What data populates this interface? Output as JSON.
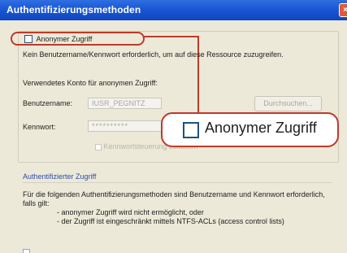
{
  "window": {
    "title": "Authentifizierungsmethoden",
    "close_label": "×"
  },
  "anonymous": {
    "checkbox_label": "Anonymer Zugriff",
    "checked": false,
    "description": "Kein Benutzername/Kennwort erforderlich, um auf diese Ressource zuzugreifen.",
    "account_label": "Verwendetes Konto für anonymen Zugriff:",
    "username_label": "Benutzername:",
    "username_value": "IUSR_PEGNITZ",
    "password_label": "Kennwort:",
    "password_value": "**********",
    "browse_label": "Durchsuchen...",
    "password_control_label": "Kennwortsteuerung zulassen"
  },
  "callout": {
    "label": "Anonymer Zugriff"
  },
  "authenticated": {
    "section_title": "Authentifizierter Zugriff",
    "paragraph": "Für die folgenden Authentifizierungsmethoden sind Benutzername und Kennwort erforderlich, falls gilt:",
    "bullets": [
      "- anonymer Zugriff wird nicht ermöglicht, oder",
      "- der Zugriff ist eingeschränkt mittels NTFS-ACLs (access control lists)"
    ]
  },
  "colors": {
    "title_bar": "#1a56d6",
    "highlight_red": "#c0392b",
    "section_blue": "#2b4da8",
    "window_bg": "#ece9d8"
  }
}
